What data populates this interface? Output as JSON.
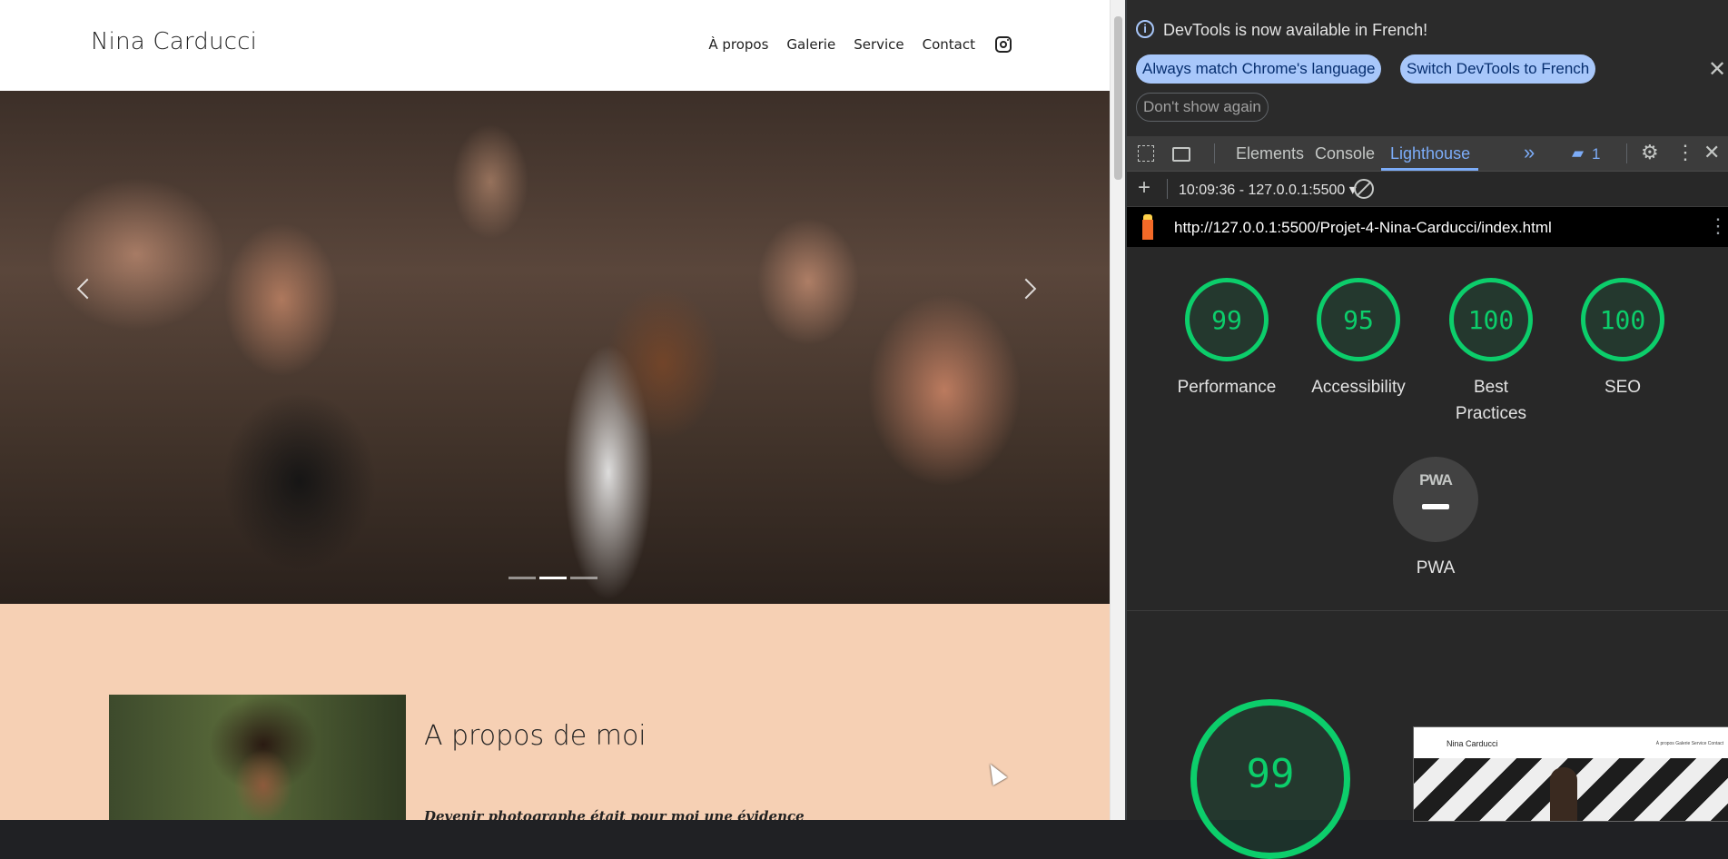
{
  "site": {
    "brand": "Nina Carducci",
    "nav": [
      "À propos",
      "Galerie",
      "Service",
      "Contact"
    ],
    "about_title": "A propos de moi",
    "about_subtitle": "Devenir photographe était pour moi une évidence"
  },
  "devtools": {
    "infobar": {
      "message": "DevTools is now available in French!",
      "always_match": "Always match Chrome's language",
      "switch_language": "Switch DevTools to French",
      "dont_show": "Don't show again"
    },
    "tabs": [
      "Elements",
      "Console",
      "Lighthouse"
    ],
    "active_tab": "Lighthouse",
    "messages_count": "1",
    "run": "10:09:36 - 127.0.0.1:5500 ▾",
    "report_url": "http://127.0.0.1:5500/Projet-4-Nina-Carducci/index.html",
    "scores": [
      {
        "label": "Performance",
        "value": "99"
      },
      {
        "label": "Accessibility",
        "value": "95"
      },
      {
        "label": "Best Practices",
        "value": "100"
      },
      {
        "label": "SEO",
        "value": "100"
      }
    ],
    "pwa": {
      "badge": "PWA",
      "label": "PWA"
    },
    "performance_big": "99",
    "thumbnail": {
      "brand": "Nina Carducci",
      "nav": "À propos   Galerie   Service   Contact"
    },
    "accent_color": "#0cce6b",
    "tab_accent": "#7cacf8"
  }
}
